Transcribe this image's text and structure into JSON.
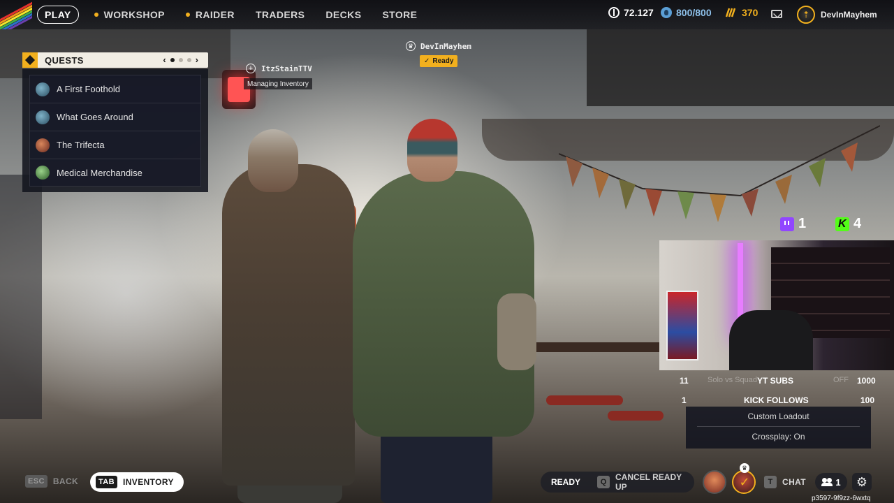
{
  "colors": {
    "accent": "#f2b01e",
    "panel_dark": "#12141e",
    "twitch": "#9146ff",
    "kick": "#53fc18",
    "rainbow": [
      "#e5322d",
      "#f49b1a",
      "#f5e72b",
      "#3fae49",
      "#2a74c9",
      "#6a3fb0"
    ]
  },
  "nav": {
    "items": [
      {
        "label": "PLAY",
        "active": true,
        "icon": ""
      },
      {
        "label": "WORKSHOP",
        "active": false,
        "icon": "alert-dot-icon"
      },
      {
        "label": "RAIDER",
        "active": false,
        "icon": "alert-dot-icon"
      },
      {
        "label": "TRADERS",
        "active": false,
        "icon": ""
      },
      {
        "label": "DECKS",
        "active": false,
        "icon": ""
      },
      {
        "label": "STORE",
        "active": false,
        "icon": ""
      }
    ]
  },
  "currencies": {
    "coins": {
      "icon": "coins-icon",
      "value": "72.127"
    },
    "seeds": {
      "icon": "seed-token-icon",
      "value": "800/800"
    },
    "cred": {
      "icon": "cred-icon",
      "value": "370"
    }
  },
  "profile": {
    "name": "DevInMayhem",
    "icon": "rank-badge-icon"
  },
  "quests": {
    "title": "QUESTS",
    "page_current": 1,
    "page_total": 3,
    "items": [
      {
        "label": "A First Foothold",
        "avatar_color": "#3d6f8a"
      },
      {
        "label": "What Goes Around",
        "avatar_color": "#3d6f8a"
      },
      {
        "label": "The Trifecta",
        "avatar_color": "#8a3b2c"
      },
      {
        "label": "Medical Merchandise",
        "avatar_color": "#3e7a3a"
      }
    ]
  },
  "squad": {
    "player1": {
      "name": "ItzStainTTV",
      "status": "Managing Inventory",
      "icon": "add-friend-icon"
    },
    "player2": {
      "name": "DevInMayhem",
      "status": "Ready",
      "icon": "crown-icon"
    }
  },
  "stream": {
    "twitch_viewers": "1",
    "kick_viewers": "4",
    "goals": [
      {
        "current": "11",
        "label": "YT SUBS",
        "target": "1000"
      },
      {
        "current": "1",
        "label": "KICK FOLLOWS",
        "target": "100"
      }
    ],
    "faded_text": {
      "left": "Solo vs Squad",
      "right": "OFF"
    }
  },
  "loadout_menu": {
    "custom_loadout": "Custom Loadout",
    "crossplay": "Crossplay: On"
  },
  "bottom": {
    "back_key": "ESC",
    "back_label": "BACK",
    "inventory_key": "TAB",
    "inventory_label": "INVENTORY",
    "ready_label": "READY",
    "cancel_key": "Q",
    "cancel_label": "CANCEL READY UP",
    "chat_key": "T",
    "chat_label": "CHAT",
    "party_count": "1",
    "session_id": "p3597-9f9zz-6wxtq"
  }
}
